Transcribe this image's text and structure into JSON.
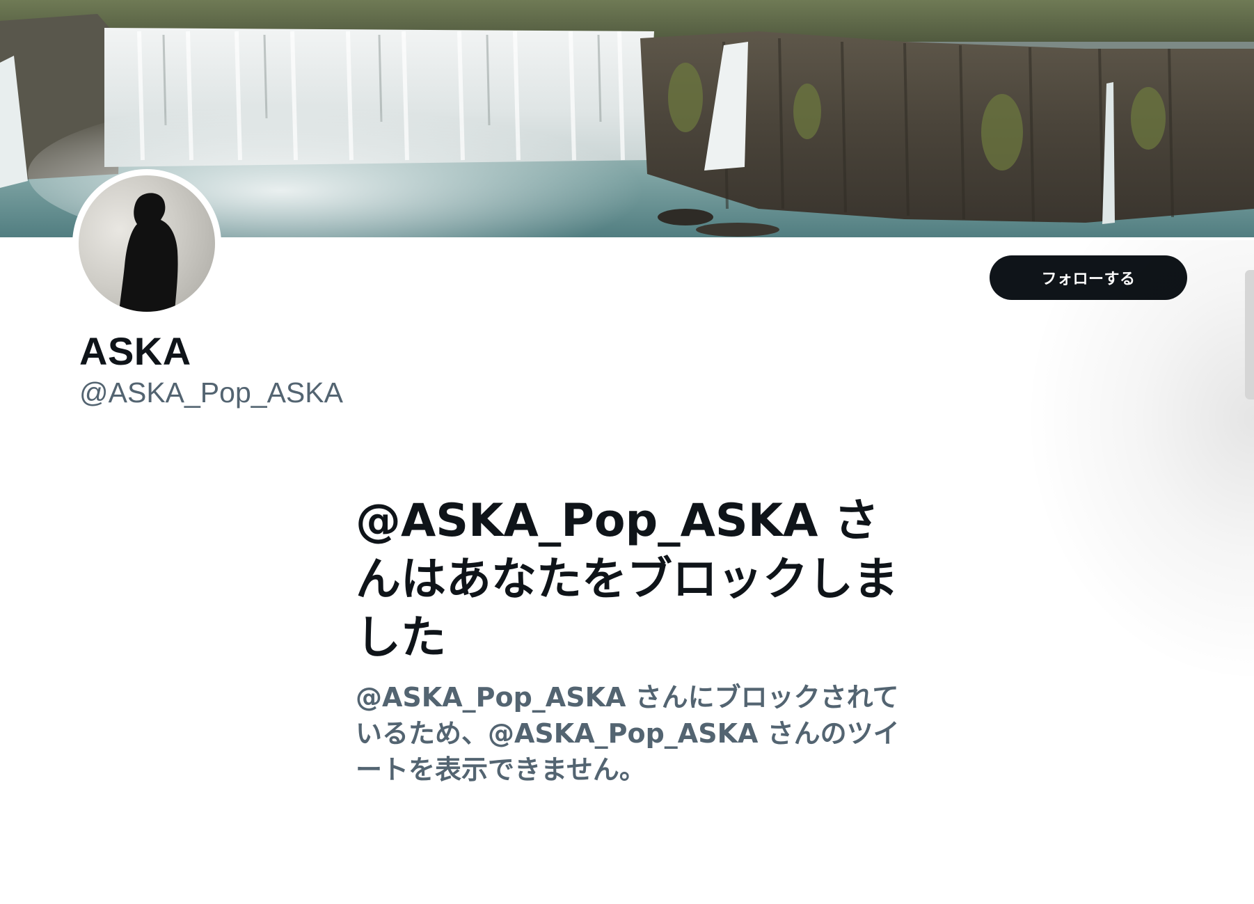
{
  "profile": {
    "display_name": "ASKA",
    "handle": "@ASKA_Pop_ASKA",
    "follow_label": "フォローする"
  },
  "blocked": {
    "title": "@ASKA_Pop_ASKA さんはあなたをブロックしました",
    "description": "@ASKA_Pop_ASKA さんにブロックされているため、@ASKA_Pop_ASKA さんのツイートを表示できません。"
  },
  "colors": {
    "primary_text": "#0f1419",
    "secondary_text": "#536471",
    "button_bg": "#0f1419",
    "button_text": "#ffffff",
    "background": "#ffffff"
  },
  "icons": {
    "banner": "waterfall-banner-image",
    "avatar": "silhouette-avatar-image"
  }
}
